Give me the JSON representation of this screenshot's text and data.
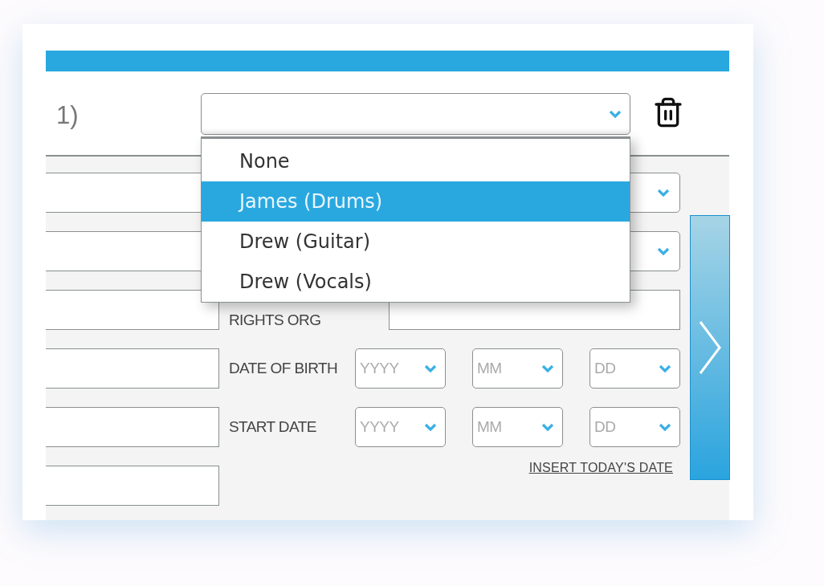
{
  "header": {
    "title_fragment": "1)"
  },
  "member_select": {
    "expanded": true,
    "options": [
      {
        "label": "None",
        "selected": false
      },
      {
        "label": "James (Drums)",
        "selected": true
      },
      {
        "label": "Drew (Guitar)",
        "selected": false
      },
      {
        "label": "Drew (Vocals)",
        "selected": false
      }
    ]
  },
  "details": {
    "rows": [
      {
        "kind": "select"
      },
      {
        "kind": "select"
      },
      {
        "kind": "text",
        "label": "RIGHTS ORG"
      },
      {
        "kind": "date",
        "label": "DATE OF BIRTH",
        "parts": [
          {
            "placeholder": "YYYY"
          },
          {
            "placeholder": "MM"
          },
          {
            "placeholder": "DD"
          }
        ]
      },
      {
        "kind": "date",
        "label": "START DATE",
        "parts": [
          {
            "placeholder": "YYYY"
          },
          {
            "placeholder": "MM"
          },
          {
            "placeholder": "DD"
          }
        ]
      }
    ],
    "link": "INSERT TODAY'S DATE"
  }
}
